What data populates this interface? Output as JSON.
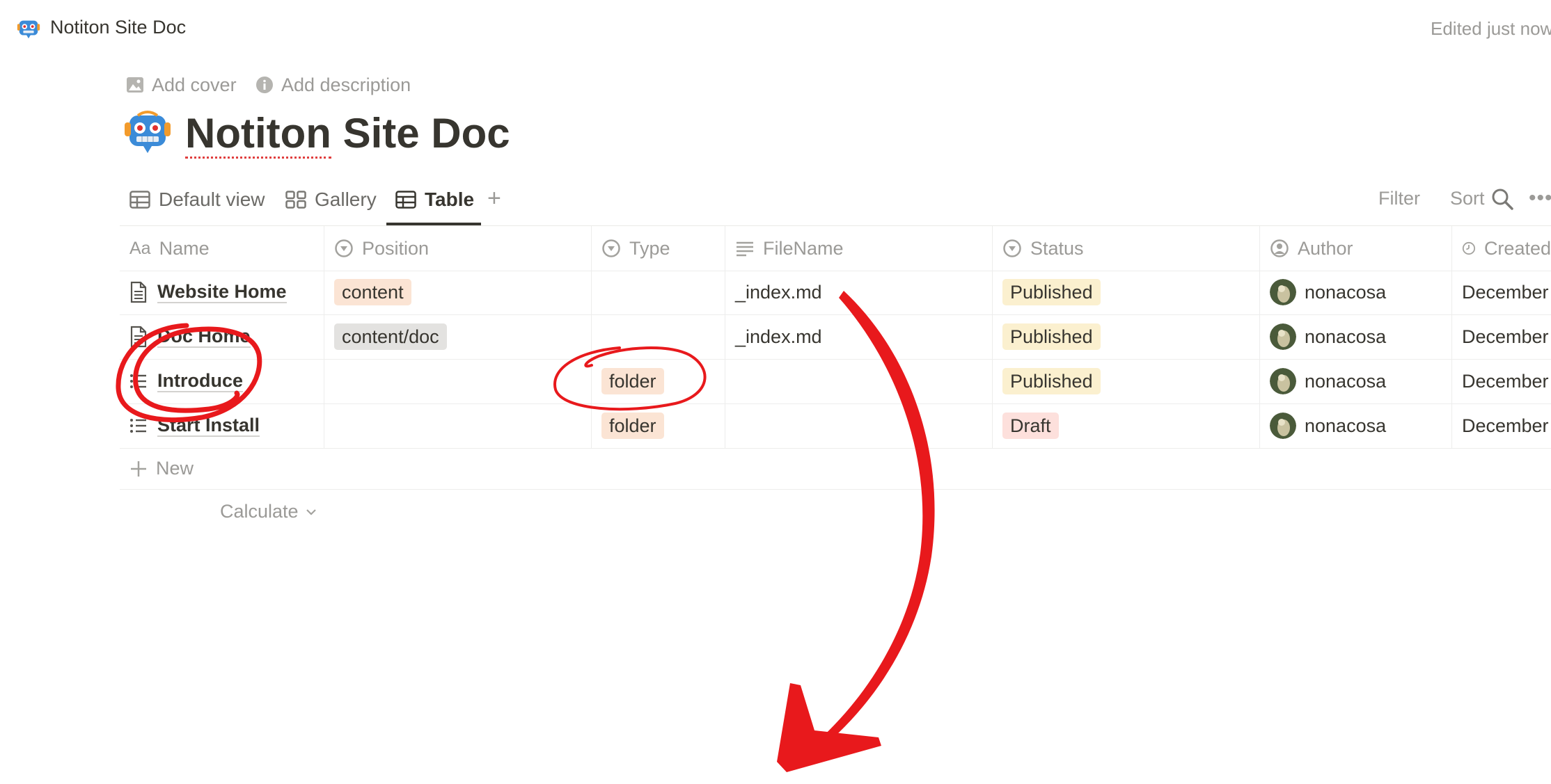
{
  "topbar": {
    "title": "Notiton Site Doc",
    "edited": "Edited just now",
    "icon": "robot-icon"
  },
  "page": {
    "add_cover": "Add cover",
    "add_description": "Add description",
    "title_first": "Notiton",
    "title_rest": " Site Doc",
    "icon": "robot-icon"
  },
  "views": {
    "tabs": [
      {
        "label": "Default view",
        "icon": "table-icon"
      },
      {
        "label": "Gallery",
        "icon": "gallery-icon"
      },
      {
        "label": "Table",
        "icon": "table-icon",
        "active": true
      }
    ],
    "add": "+",
    "filter": "Filter",
    "sort": "Sort",
    "more": "•••"
  },
  "table": {
    "headers": {
      "name": "Name",
      "name_icon": "Aa",
      "position": "Position",
      "type": "Type",
      "filename": "FileName",
      "status": "Status",
      "author": "Author",
      "created": "Created"
    },
    "rows": [
      {
        "name": "Website Home",
        "icon": "page-icon",
        "position": "content",
        "type": "",
        "filename": "_index.md",
        "status": "Published",
        "author": "nonacosa",
        "created": "December"
      },
      {
        "name": "Doc Home",
        "icon": "page-icon",
        "position": "content/doc",
        "type": "",
        "filename": "_index.md",
        "status": "Published",
        "author": "nonacosa",
        "created": "December"
      },
      {
        "name": "Introduce",
        "icon": "list-icon",
        "position": "",
        "type": "folder",
        "filename": "",
        "status": "Published",
        "author": "nonacosa",
        "created": "December"
      },
      {
        "name": "Start Install",
        "icon": "list-icon",
        "position": "",
        "type": "folder",
        "filename": "",
        "status": "Draft",
        "author": "nonacosa",
        "created": "December"
      }
    ],
    "new_label": "New",
    "calculate_label": "Calculate"
  },
  "colors": {
    "annotation_red": "#e8191c",
    "tag_orange": "#fbe4d4",
    "tag_gray": "#e3e2e0",
    "tag_yellow": "#fbf0cf",
    "tag_red": "#fde0dc"
  }
}
